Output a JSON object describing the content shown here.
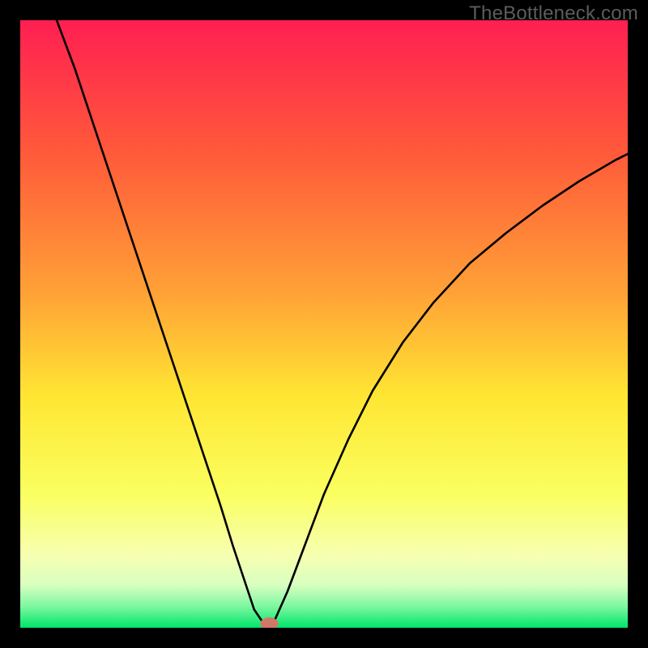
{
  "watermark": "TheBottleneck.com",
  "chart_data": {
    "type": "line",
    "title": "",
    "xlabel": "",
    "ylabel": "",
    "xlim": [
      0,
      100
    ],
    "ylim": [
      0,
      100
    ],
    "grid": false,
    "legend": false,
    "gradient_stops": [
      {
        "pos": 0.0,
        "color": "#ff1f52"
      },
      {
        "pos": 0.22,
        "color": "#ff5a3a"
      },
      {
        "pos": 0.45,
        "color": "#ffa236"
      },
      {
        "pos": 0.62,
        "color": "#ffe633"
      },
      {
        "pos": 0.78,
        "color": "#faff60"
      },
      {
        "pos": 0.88,
        "color": "#f7ffb0"
      },
      {
        "pos": 0.93,
        "color": "#d8ffc0"
      },
      {
        "pos": 0.965,
        "color": "#7cf7a0"
      },
      {
        "pos": 1.0,
        "color": "#00e56a"
      }
    ],
    "series": [
      {
        "name": "bottleneck-curve",
        "x": [
          6.0,
          9.0,
          12.0,
          15.0,
          18.0,
          21.0,
          24.0,
          27.0,
          30.0,
          33.0,
          35.0,
          37.0,
          38.5,
          40.0,
          41.0,
          42.0,
          44.0,
          47.0,
          50.0,
          54.0,
          58.0,
          63.0,
          68.0,
          74.0,
          80.0,
          86.0,
          92.0,
          98.0,
          100.0
        ],
        "y": [
          100.0,
          92.0,
          83.0,
          74.0,
          65.0,
          56.0,
          47.0,
          38.0,
          29.0,
          20.0,
          13.5,
          7.5,
          3.0,
          0.8,
          0.5,
          1.5,
          6.0,
          14.0,
          22.0,
          31.0,
          39.0,
          47.0,
          53.5,
          60.0,
          65.0,
          69.5,
          73.5,
          77.0,
          78.0
        ]
      }
    ],
    "marker": {
      "x": 41.0,
      "y": 0.0,
      "color": "#d07868",
      "rx": 1.5,
      "ry": 1.0
    }
  }
}
